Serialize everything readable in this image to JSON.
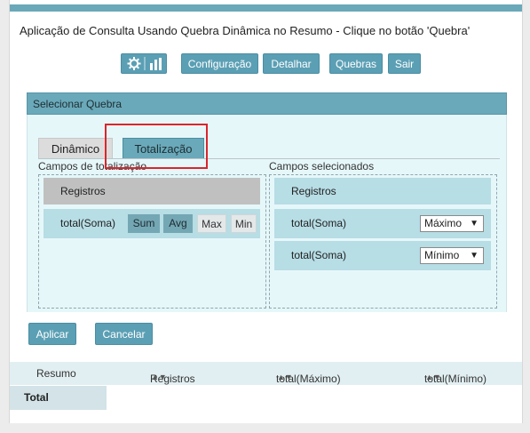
{
  "title": "Aplicação de Consulta Usando Quebra Dinâmica no Resumo - Clique no botão 'Quebra'",
  "toolbar": {
    "icons": [
      "gear-icon",
      "bar-chart-icon"
    ],
    "buttons": [
      "Configuração",
      "Detalhar",
      "Quebras",
      "Sair"
    ]
  },
  "panel": {
    "title": "Selecionar Quebra",
    "tabs": [
      "Dinâmico",
      "Totalização"
    ],
    "active_tab": "Totalização",
    "left": {
      "label": "Campos de totalização",
      "group": "Registros",
      "field": "total(Soma)",
      "aggregates": [
        "Sum",
        "Avg",
        "Max",
        "Min"
      ]
    },
    "right": {
      "label": "Campos selecionados",
      "group": "Registros",
      "rows": [
        {
          "field": "total(Soma)",
          "func": "Máximo"
        },
        {
          "field": "total(Soma)",
          "func": "Mínimo"
        }
      ]
    },
    "apply": "Aplicar",
    "cancel": "Cancelar"
  },
  "results": {
    "headers": [
      "Resumo",
      "Registros",
      "total(Máximo)",
      "total(Mínimo)"
    ],
    "row_label": "Total"
  },
  "colors": {
    "accent": "#6aa9b9",
    "highlight": "#d9262b"
  }
}
